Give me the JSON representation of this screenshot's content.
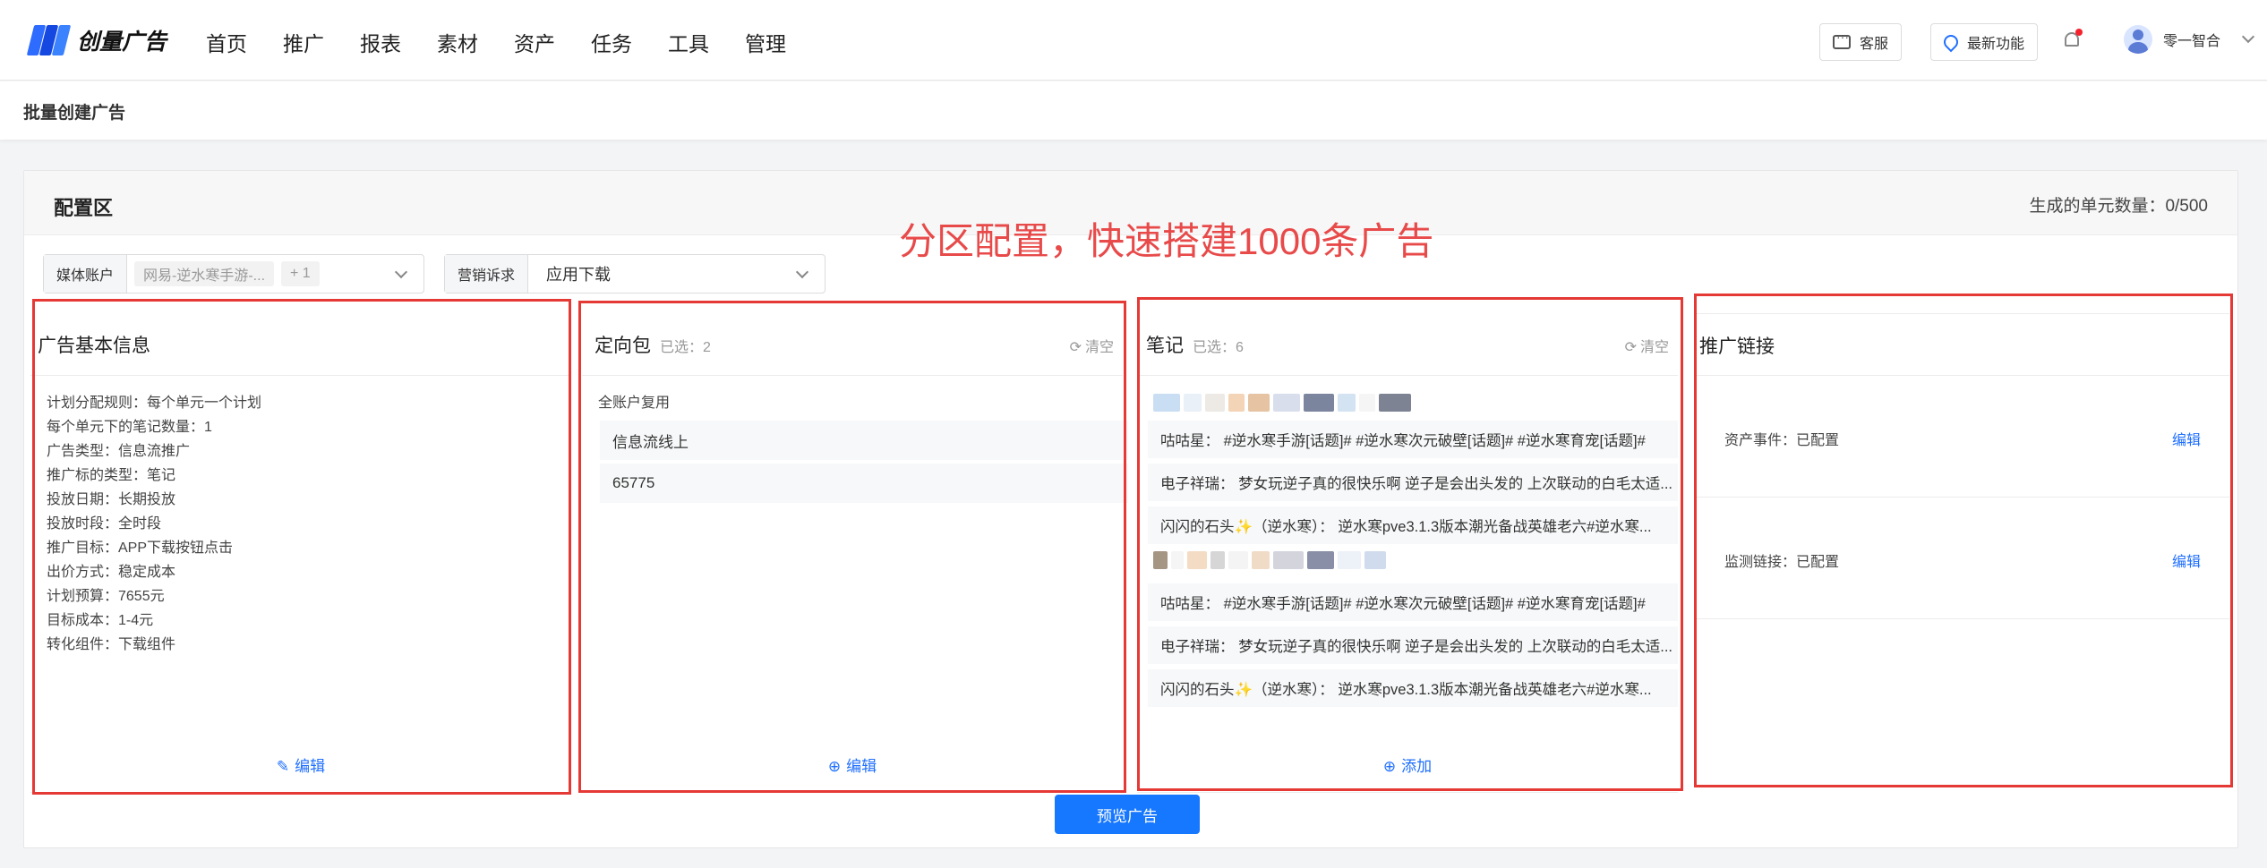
{
  "brand": {
    "name": "创量广告"
  },
  "nav": {
    "menu": [
      "首页",
      "推广",
      "报表",
      "素材",
      "资产",
      "任务",
      "工具",
      "管理"
    ],
    "service_label": "客服",
    "new_features_label": "最新功能",
    "user_name": "零一智合"
  },
  "page": {
    "title": "批量创建广告"
  },
  "panel": {
    "title": "配置区",
    "unit_count": "生成的单元数量：0/500",
    "promo_text": "分区配置，快速搭建1000条广告"
  },
  "filters": {
    "media_account": {
      "label": "媒体账户",
      "tag": "网易-逆水寒手游-...",
      "extra": "+ 1"
    },
    "marketing_goal": {
      "label": "营销诉求",
      "value": "应用下载"
    }
  },
  "basic_info": {
    "title": "广告基本信息",
    "lines": [
      "计划分配规则：每个单元一个计划",
      "每个单元下的笔记数量：1",
      "广告类型：信息流推广",
      "推广标的类型：笔记",
      "投放日期：长期投放",
      "投放时段：全时段",
      "推广目标：APP下载按钮点击",
      "出价方式：稳定成本",
      "计划预算：7655元",
      "目标成本：1-4元",
      "转化组件：下载组件"
    ],
    "action": "编辑"
  },
  "targeting": {
    "title": "定向包",
    "selected": "已选：2",
    "clear": "清空",
    "group_label": "全账户复用",
    "rows": [
      "信息流线上",
      "65775"
    ],
    "action": "编辑"
  },
  "notes": {
    "title": "笔记",
    "selected": "已选：6",
    "clear": "清空",
    "rows": [
      "咕咕星：  #逆水寒手游[话题]# #逆水寒次元破壁[话题]# #逆水寒育宠[话题]#",
      "电子祥瑞：  梦女玩逆子真的很快乐啊 逆子是会出头发的 上次联动的白毛太适...",
      "闪闪的石头✨（逆水寒）：  逆水寒pve3.1.3版本潮光备战英雄老六#逆水寒...",
      "咕咕星：  #逆水寒手游[话题]# #逆水寒次元破壁[话题]# #逆水寒育宠[话题]#",
      "电子祥瑞：  梦女玩逆子真的很快乐啊 逆子是会出头发的 上次联动的白毛太适...",
      "闪闪的石头✨（逆水寒）：  逆水寒pve3.1.3版本潮光备战英雄老六#逆水寒..."
    ],
    "action": "添加"
  },
  "promo_links": {
    "title": "推广链接",
    "rows": [
      {
        "label": "资产事件：已配置",
        "action": "编辑"
      },
      {
        "label": "监测链接：已配置",
        "action": "编辑"
      }
    ]
  },
  "preview_button": "预览广告",
  "colors": {
    "accent": "#1677ff",
    "highlight": "#e53935",
    "promo": "#e84a4a"
  }
}
